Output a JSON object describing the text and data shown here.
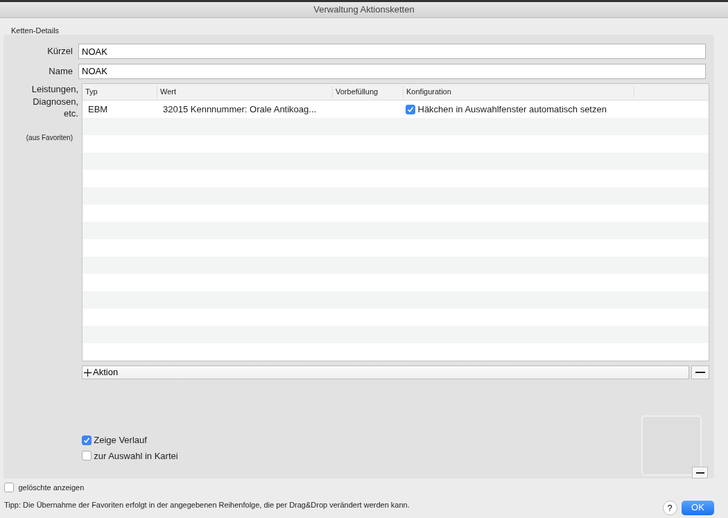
{
  "window": {
    "title": "Verwaltung Aktionsketten"
  },
  "group_title": "Ketten-Details",
  "fields": [
    {
      "label": "Kürzel",
      "value": "NOAK"
    },
    {
      "label": "Name",
      "value": "NOAK"
    }
  ],
  "table_label": "Leistungen, Diagnosen, etc.",
  "table_note": "(aus Favoriten)",
  "table": {
    "columns": [
      "Typ",
      "Wert",
      "Vorbefüllung",
      "Konfiguration"
    ],
    "rows": [
      {
        "typ": "EBM",
        "wert": "32015 Kennnummer: Orale Antikoag...",
        "konfiguration": {
          "checked": true,
          "label": "Häkchen in Auswahlfenster automatisch setzen"
        }
      }
    ],
    "add_button": "Aktion"
  },
  "options": [
    {
      "label": "Zeige Verlauf",
      "checked": true
    },
    {
      "label": "zur Auswahl in Kartei",
      "checked": false
    }
  ],
  "show_deleted": {
    "label": "gelöschte anzeigen",
    "checked": false
  },
  "tip": "Tipp: Die Übernahme der Favoriten erfolgt in der angegebenen Reihenfolge, die per Drag&Drop verändert werden kann.",
  "buttons": {
    "help": "?",
    "ok": "OK"
  }
}
